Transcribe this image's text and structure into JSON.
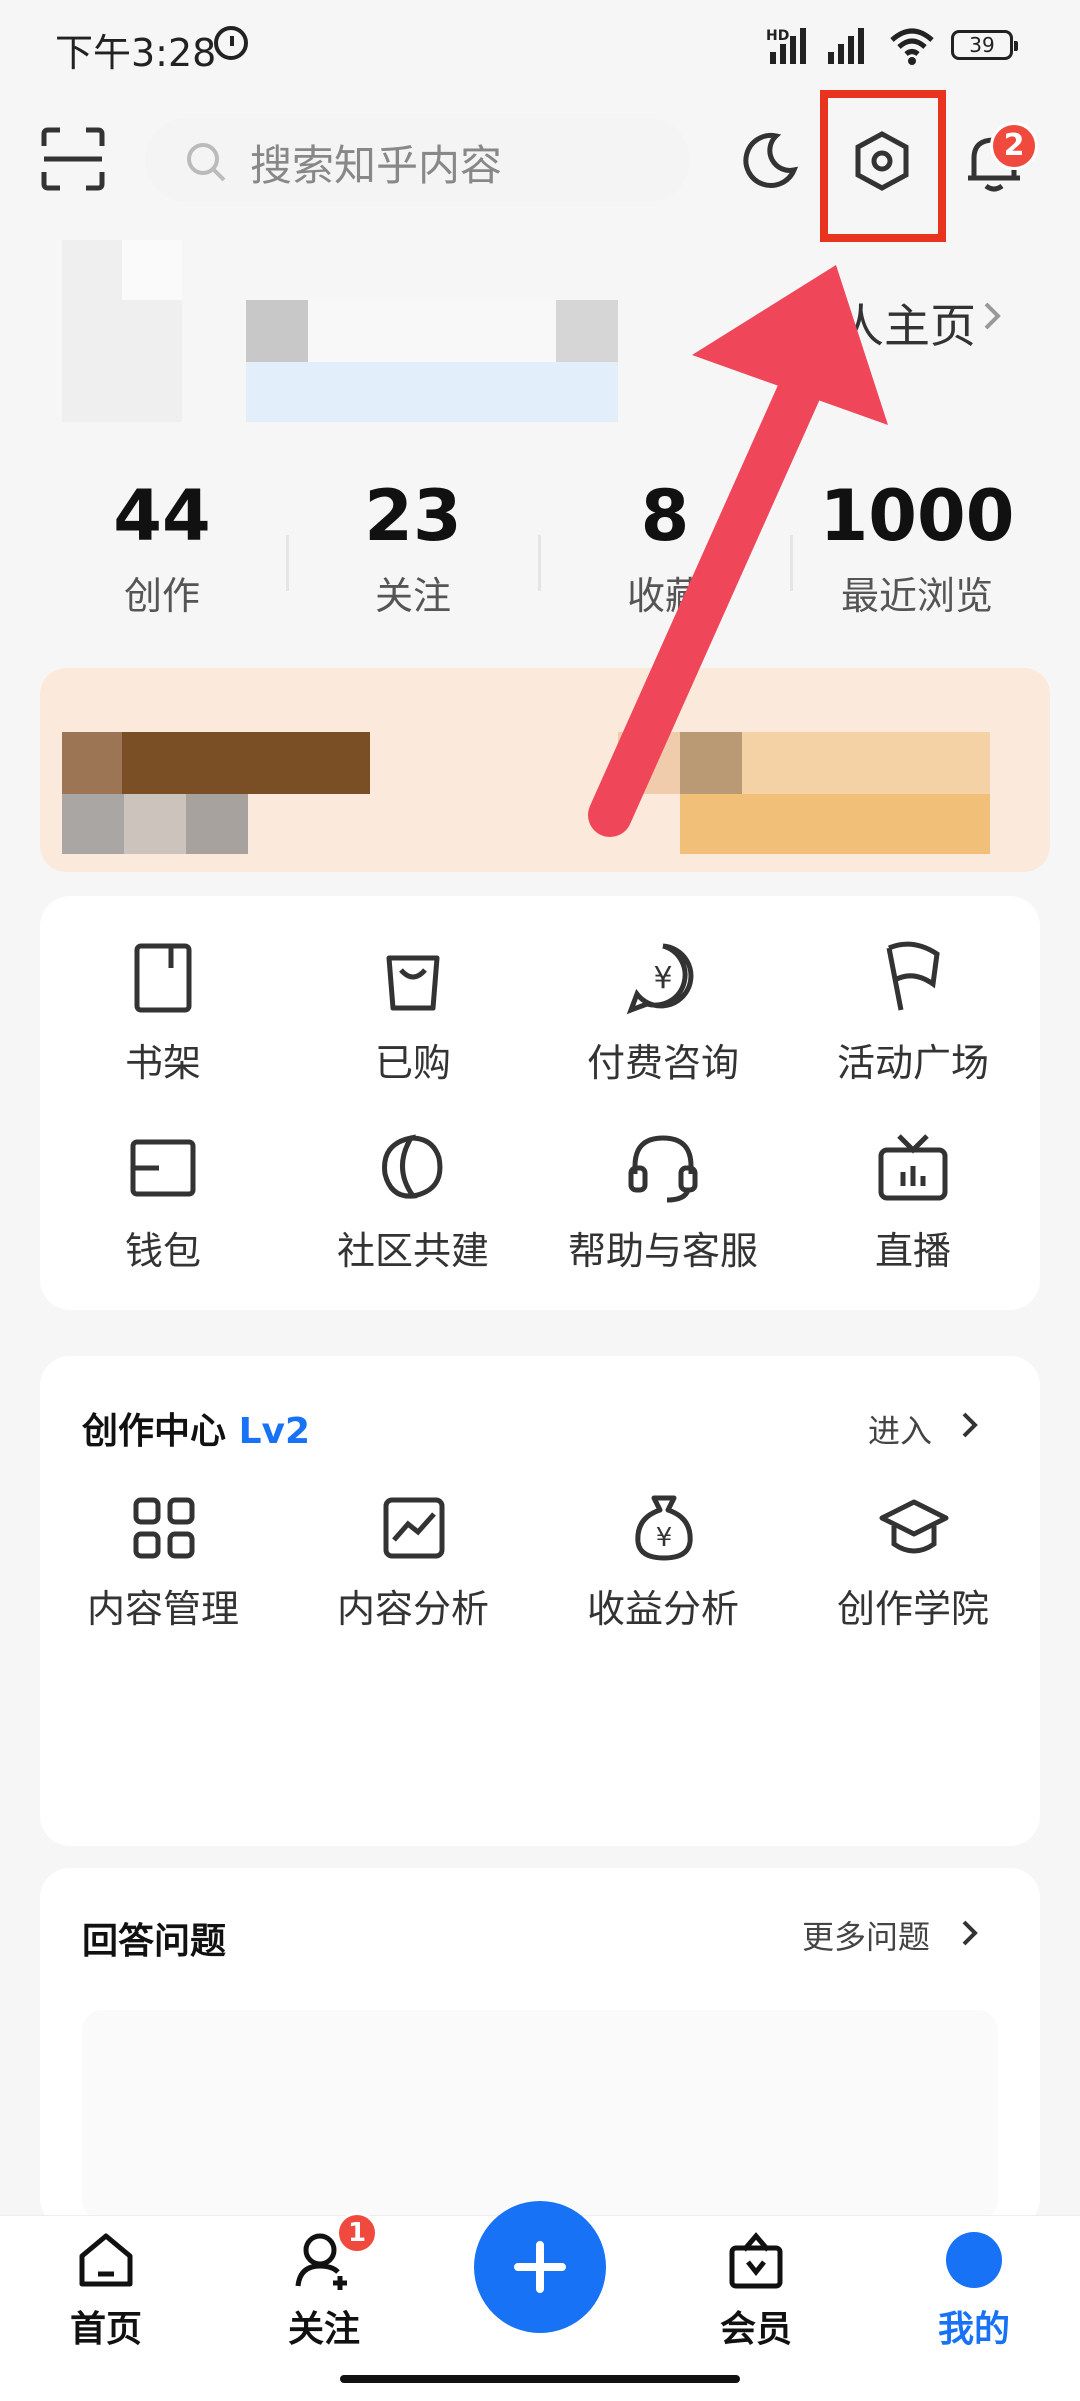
{
  "status": {
    "time": "下午3:28",
    "net_label": "HD",
    "battery": "39"
  },
  "top": {
    "search_placeholder": "搜索知乎内容",
    "notif_count": "2"
  },
  "profile": {
    "link_label": "人主页"
  },
  "stats": [
    {
      "num": "44",
      "label": "创作"
    },
    {
      "num": "23",
      "label": "关注"
    },
    {
      "num": "8",
      "label": "收藏"
    },
    {
      "num": "1000",
      "label": "最近浏览"
    }
  ],
  "services": [
    {
      "label": "书架",
      "icon": "bookshelf-icon"
    },
    {
      "label": "已购",
      "icon": "shopping-bag-icon"
    },
    {
      "label": "付费咨询",
      "icon": "paid-consult-icon"
    },
    {
      "label": "活动广场",
      "icon": "flag-icon"
    },
    {
      "label": "钱包",
      "icon": "wallet-icon"
    },
    {
      "label": "社区共建",
      "icon": "community-icon"
    },
    {
      "label": "帮助与客服",
      "icon": "headset-icon"
    },
    {
      "label": "直播",
      "icon": "tv-icon"
    }
  ],
  "creator": {
    "title": "创作中心",
    "level": "Lv2",
    "enter": "进入",
    "items": [
      {
        "label": "内容管理",
        "icon": "grid-icon"
      },
      {
        "label": "内容分析",
        "icon": "chart-icon"
      },
      {
        "label": "收益分析",
        "icon": "money-bag-icon"
      },
      {
        "label": "创作学院",
        "icon": "graduation-cap-icon"
      }
    ]
  },
  "answer": {
    "title": "回答问题",
    "more": "更多问题"
  },
  "nav": {
    "home": "首页",
    "follow": "关注",
    "follow_badge": "1",
    "vip": "会员",
    "me": "我的"
  },
  "colors": {
    "accent": "#1772f6",
    "highlight": "#e8341f",
    "badge": "#f04a3f"
  }
}
